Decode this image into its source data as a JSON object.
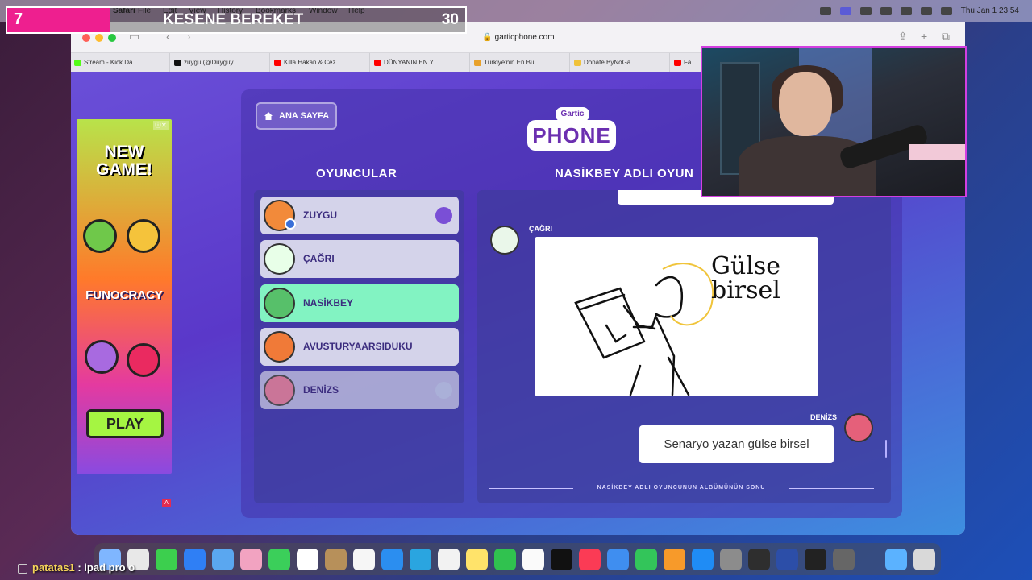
{
  "menubar": {
    "app": "Safari",
    "items": [
      "File",
      "Edit",
      "View",
      "History",
      "Bookmarks",
      "Window",
      "Help"
    ],
    "clock": "Thu Jan 1  23:54"
  },
  "overlay": {
    "number": "7",
    "title": "KESENE BEREKET",
    "count": "30"
  },
  "browser": {
    "url": "garticphone.com",
    "tabs": [
      "Stream - Kick Da...",
      "zuygu (@Duyguy...",
      "Killa Hakan & Cez...",
      "DÜNYANIN EN Y...",
      "Türkiye'nin En Bü...",
      "Donate ByNoGa...",
      "Fa"
    ]
  },
  "ad": {
    "headline": "NEW GAME!",
    "brand": "FUNOCRACY",
    "play": "PLAY",
    "badge": "A"
  },
  "game": {
    "home_button": "ANA SAYFA",
    "logo_top": "Gartic",
    "logo_main": "PHONE",
    "players_heading": "OYUNCULAR",
    "album_heading": "NASİKBEY ADLI OYUN",
    "players": [
      {
        "name": "ZUYGU",
        "status": "host"
      },
      {
        "name": "ÇAĞRI",
        "status": ""
      },
      {
        "name": "NASİKBEY",
        "status": "active"
      },
      {
        "name": "AVUSTURYAARSIDUKU",
        "status": ""
      },
      {
        "name": "DENİZS",
        "status": "left"
      }
    ],
    "album": {
      "previous_snippet": "",
      "drawing_author": "ÇAĞRI",
      "drawing_text": "Gülse birsel",
      "caption_author": "DENİZS",
      "caption": "Senaryo yazan gülse birsel",
      "end_label": "NASİKBEY ADLI OYUNCUNUN ALBÜMÜNÜN SONU"
    }
  },
  "chat": {
    "user": "patatas1",
    "message": " : ipad pro o"
  },
  "colors": {
    "overlay_accent": "#ee1f8f",
    "active_player": "#82f3c2",
    "webcam_border": "#d33fe0"
  }
}
